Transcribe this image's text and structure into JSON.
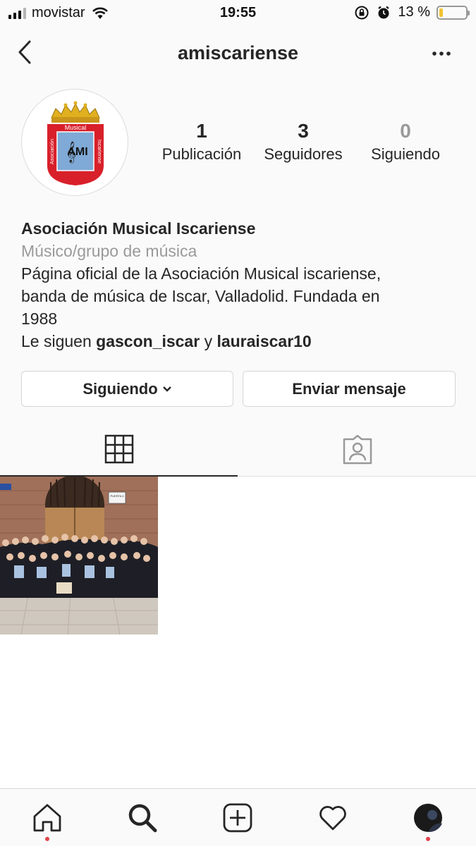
{
  "status_bar": {
    "carrier": "movistar",
    "time": "19:55",
    "battery_percent": "13 %",
    "battery_level": 0.13
  },
  "header": {
    "title": "amiscariense"
  },
  "profile": {
    "avatar_logo_text": [
      "Musical",
      "Asociación",
      "Iscariense",
      "AMI"
    ],
    "stats": [
      {
        "value": "1",
        "label": "Publicación"
      },
      {
        "value": "3",
        "label": "Seguidores"
      },
      {
        "value": "0",
        "label": "Siguiendo"
      }
    ],
    "name": "Asociación Musical Iscariense",
    "category": "Músico/grupo de música",
    "bio_lines": [
      "Página oficial de la Asociación Musical iscariense,",
      "banda de música de Iscar, Valladolid. Fundada en",
      "1988"
    ],
    "followed_by_prefix": "Le siguen",
    "followed_by_user1": "gascon_iscar",
    "followed_by_join": "y",
    "followed_by_user2": "lauraiscar10"
  },
  "actions": {
    "following_label": "Siguiendo",
    "message_label": "Enviar mensaje"
  },
  "tabs": {
    "grid_icon": "grid-icon",
    "tagged_icon": "tagged-icon"
  },
  "posts": [
    {
      "description": "group-photo",
      "sign_text": "PUERTA 4"
    }
  ],
  "tab_bar": {
    "icons": [
      "home-icon",
      "search-icon",
      "add-icon",
      "heart-icon",
      "profile-avatar"
    ]
  },
  "colors": {
    "notification_dot": "#e0434b",
    "battery": "#f2c230"
  }
}
